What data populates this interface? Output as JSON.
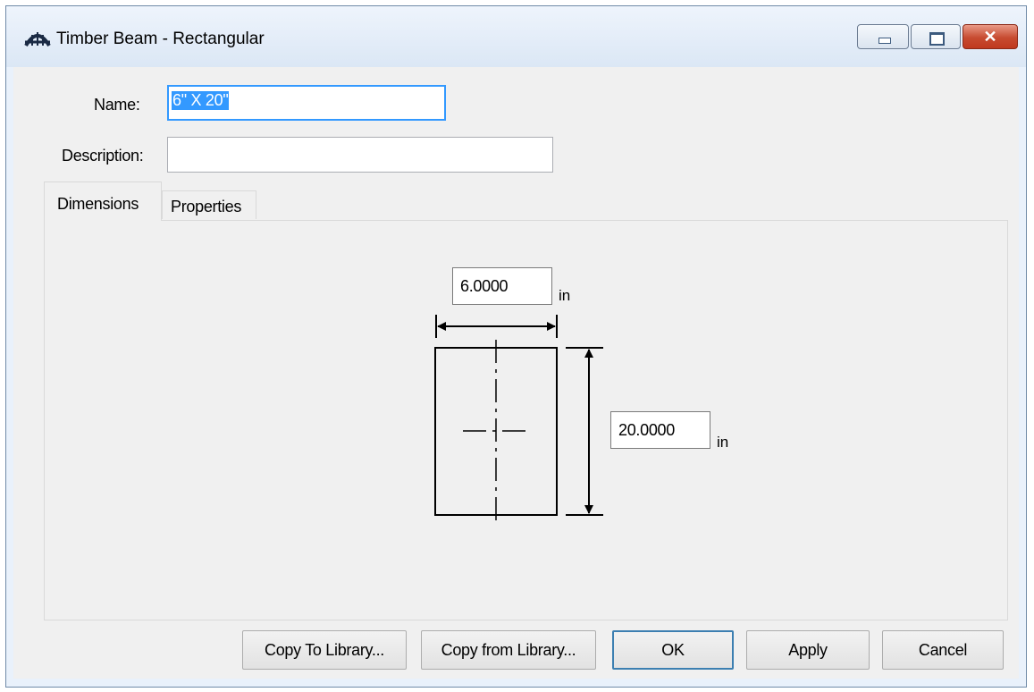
{
  "window": {
    "title": "Timber Beam - Rectangular"
  },
  "form": {
    "name_label": "Name:",
    "name_value": "6\" X 20\"",
    "description_label": "Description:",
    "description_value": ""
  },
  "tabs": [
    {
      "label": "Dimensions",
      "active": true
    },
    {
      "label": "Properties",
      "active": false
    }
  ],
  "dimensions": {
    "width_value": "6.0000",
    "width_unit": "in",
    "depth_value": "20.0000",
    "depth_unit": "in"
  },
  "buttons": {
    "copy_to_library": "Copy To Library...",
    "copy_from_library": "Copy from Library...",
    "ok": "OK",
    "apply": "Apply",
    "cancel": "Cancel"
  },
  "title_buttons": {
    "close_glyph": "✕"
  },
  "colors": {
    "selection": "#3399ff",
    "close_button": "#c74b30",
    "focus_border": "#3399ff"
  },
  "icons": [
    "bridge-icon",
    "minimize-icon",
    "maximize-icon",
    "close-icon"
  ]
}
